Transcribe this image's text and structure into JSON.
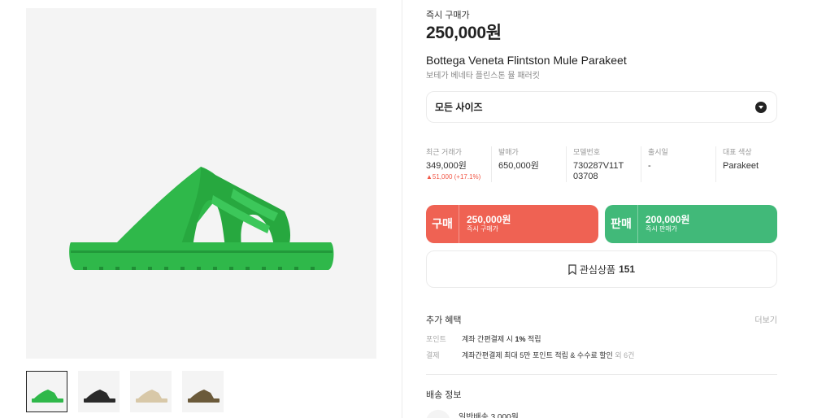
{
  "product": {
    "instant_label": "즉시 구매가",
    "price": "250,000원",
    "title_en": "Bottega Veneta Flintston Mule Parakeet",
    "title_ko": "보테가 베네타 플린스톤 뮬 패러킷",
    "color_hex": "#2fb84a"
  },
  "size_select": {
    "label": "모든 사이즈",
    "icon": "chevron-down-icon"
  },
  "stats": [
    {
      "header": "최근 거래가",
      "value": "349,000원",
      "change": "▲51,000 (+17.1%)"
    },
    {
      "header": "발매가",
      "value": "650,000원"
    },
    {
      "header": "모델번호",
      "value": "730287V11T03708"
    },
    {
      "header": "출시일",
      "value": "-"
    },
    {
      "header": "대표 색상",
      "value": "Parakeet"
    }
  ],
  "buy": {
    "title": "구매",
    "price": "250,000원",
    "sub": "즉시 구매가",
    "color": "#ef6253"
  },
  "sell": {
    "title": "판매",
    "price": "200,000원",
    "sub": "즉시 판매가",
    "color": "#41b979"
  },
  "wish": {
    "label": "관심상품",
    "count": "151",
    "icon": "bookmark-icon"
  },
  "benefits": {
    "title": "추가 혜택",
    "more": "더보기",
    "rows": [
      {
        "key": "포인트",
        "text": "계좌 간편결제 시 ",
        "bold": "1%",
        "tail": " 적립",
        "muted": ""
      },
      {
        "key": "결제",
        "text": "계좌간편결제 최대 5만 포인트 적립 & 수수료 할인 ",
        "bold": "",
        "tail": "",
        "muted": "외 6건"
      }
    ]
  },
  "shipping": {
    "title": "배송 정보",
    "item": "일반배송 3,000원"
  },
  "thumbs": [
    {
      "name": "green",
      "color": "#2fb84a"
    },
    {
      "name": "black",
      "color": "#2a2a2a"
    },
    {
      "name": "beige",
      "color": "#d8c8a8"
    },
    {
      "name": "olive",
      "color": "#6b5a3a"
    }
  ]
}
